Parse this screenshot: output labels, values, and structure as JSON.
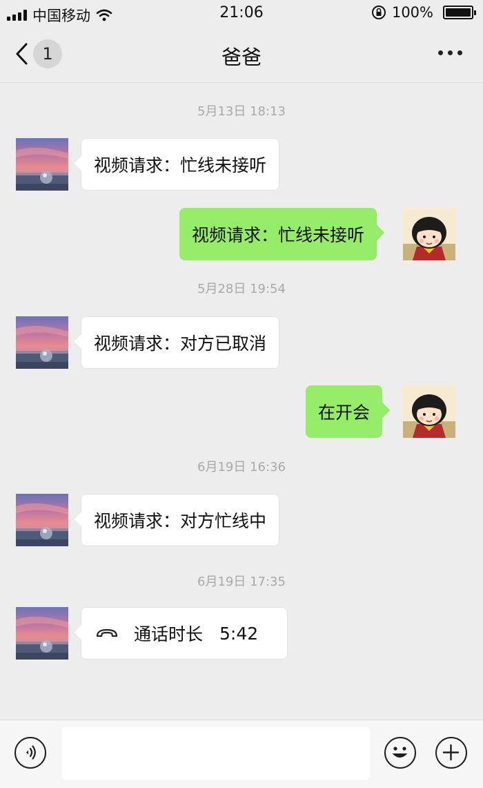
{
  "status_bar": {
    "carrier": "中国移动",
    "time": "21:06",
    "battery": "100%"
  },
  "nav": {
    "unread_count": "1",
    "title": "爸爸"
  },
  "messages": [
    {
      "timestamp": "5月13日 18:13"
    },
    {
      "side": "left",
      "text": "视频请求：忙线未接听"
    },
    {
      "side": "right",
      "text": "视频请求：忙线未接听"
    },
    {
      "timestamp": "5月28日 19:54"
    },
    {
      "side": "left",
      "text": "视频请求：对方已取消"
    },
    {
      "side": "right",
      "text": "在开会"
    },
    {
      "timestamp": "6月19日 16:36"
    },
    {
      "side": "left",
      "text": "视频请求：对方忙线中"
    },
    {
      "timestamp": "6月19日 17:35"
    },
    {
      "side": "left",
      "text": "通话时长",
      "duration": "5:42"
    }
  ],
  "input_bar": {
    "placeholder": ""
  },
  "colors": {
    "background": "#ededed",
    "bubble_sent": "#95ec69",
    "bubble_received": "#ffffff",
    "timestamp": "#a9a9a9"
  },
  "icons": {
    "back": "chevron-left-icon",
    "more": "more-dots-icon",
    "voice": "voice-icon",
    "emoji": "emoji-icon",
    "plus": "plus-icon",
    "call": "phone-hangup-icon"
  }
}
